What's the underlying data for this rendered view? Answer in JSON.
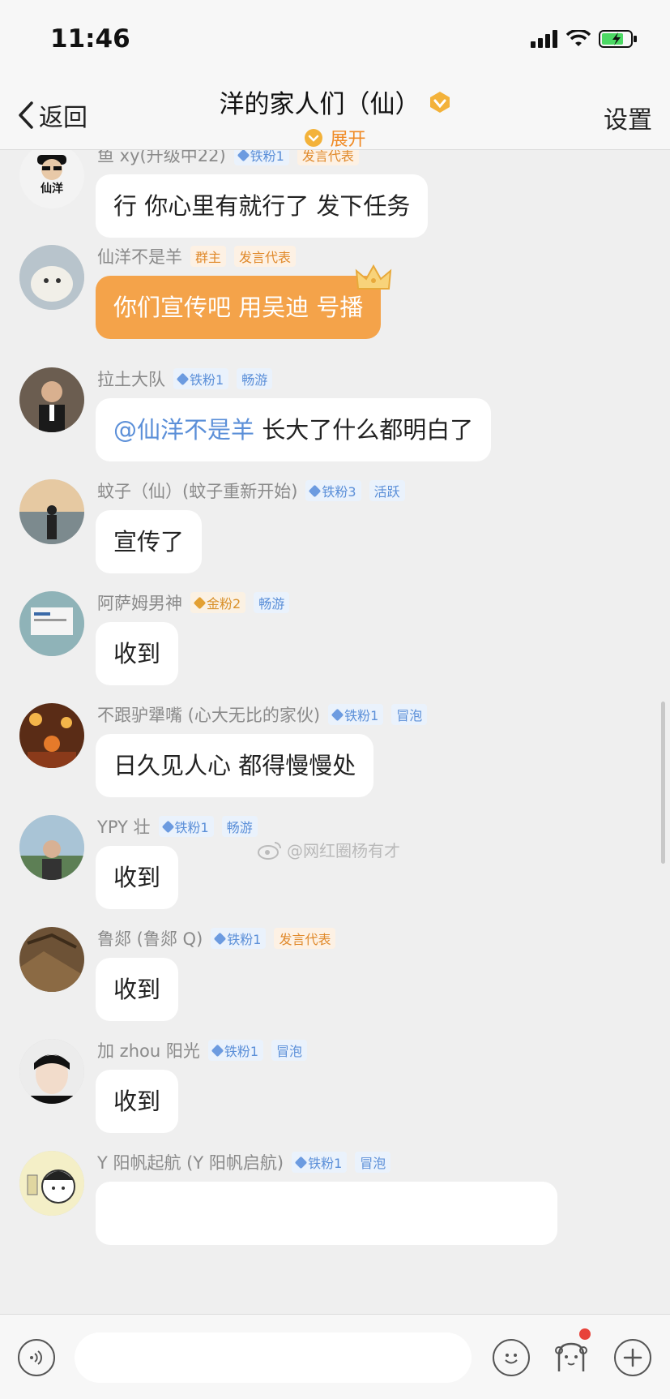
{
  "status": {
    "time": "11:46"
  },
  "nav": {
    "back_label": "返回",
    "title": "洋的家人们（仙）",
    "expand_label": "展开",
    "settings_label": "设置"
  },
  "watermark": "@网红圈杨有才",
  "messages": [
    {
      "nick": "鱼 xy(升级中22)",
      "badges": [
        {
          "type": "fan",
          "text": "铁粉1"
        },
        {
          "type": "role",
          "text": "发言代表"
        }
      ],
      "text": "行 你心里有就行了 发下任务",
      "avatar_text": "仙洋"
    },
    {
      "nick": "仙洋不是羊",
      "badges": [
        {
          "type": "role",
          "text": "群主"
        },
        {
          "type": "role",
          "text": "发言代表"
        }
      ],
      "text": "你们宣传吧 用吴迪 号播",
      "owner": true
    },
    {
      "nick": "拉土大队",
      "badges": [
        {
          "type": "fan",
          "text": "铁粉1"
        },
        {
          "type": "lvl",
          "text": "畅游"
        }
      ],
      "mention": "@仙洋不是羊",
      "text": " 长大了什么都明白了"
    },
    {
      "nick": "蚊子（仙）(蚊子重新开始)",
      "badges": [
        {
          "type": "fan",
          "text": "铁粉3"
        },
        {
          "type": "lvl",
          "text": "活跃"
        }
      ],
      "text": "宣传了"
    },
    {
      "nick": "阿萨姆男神",
      "badges": [
        {
          "type": "gold",
          "text": "金粉2"
        },
        {
          "type": "lvl",
          "text": "畅游"
        }
      ],
      "text": "收到"
    },
    {
      "nick": "不跟驴犟嘴 (心大无比的家伙)",
      "badges": [
        {
          "type": "fan",
          "text": "铁粉1"
        },
        {
          "type": "lvl",
          "text": "冒泡"
        }
      ],
      "text": "日久见人心 都得慢慢处"
    },
    {
      "nick": "YPY 壮",
      "badges": [
        {
          "type": "fan",
          "text": "铁粉1"
        },
        {
          "type": "lvl",
          "text": "畅游"
        }
      ],
      "text": "收到"
    },
    {
      "nick": "鲁郯 (鲁郯 Q)",
      "badges": [
        {
          "type": "fan",
          "text": "铁粉1"
        },
        {
          "type": "role",
          "text": "发言代表"
        }
      ],
      "text": "收到"
    },
    {
      "nick": "加 zhou 阳光",
      "badges": [
        {
          "type": "fan",
          "text": "铁粉1"
        },
        {
          "type": "lvl",
          "text": "冒泡"
        }
      ],
      "text": "收到"
    },
    {
      "nick": "Y 阳帆起航 (Y 阳帆启航)",
      "badges": [
        {
          "type": "fan",
          "text": "铁粉1"
        },
        {
          "type": "lvl",
          "text": "冒泡"
        }
      ],
      "text": ""
    }
  ],
  "avatar_colors": [
    "#1e1e1e",
    "#cfd6da",
    "#5a4f46",
    "#8a8f8a",
    "#7aa0a8",
    "#b5542a",
    "#6b8a6e",
    "#7a5a3a",
    "#d8d8d8",
    "#e9e3b8"
  ],
  "colors": {
    "accent_orange": "#f4a34a",
    "fan_badge": "#5b8fd8",
    "role_badge": "#e0892a"
  }
}
